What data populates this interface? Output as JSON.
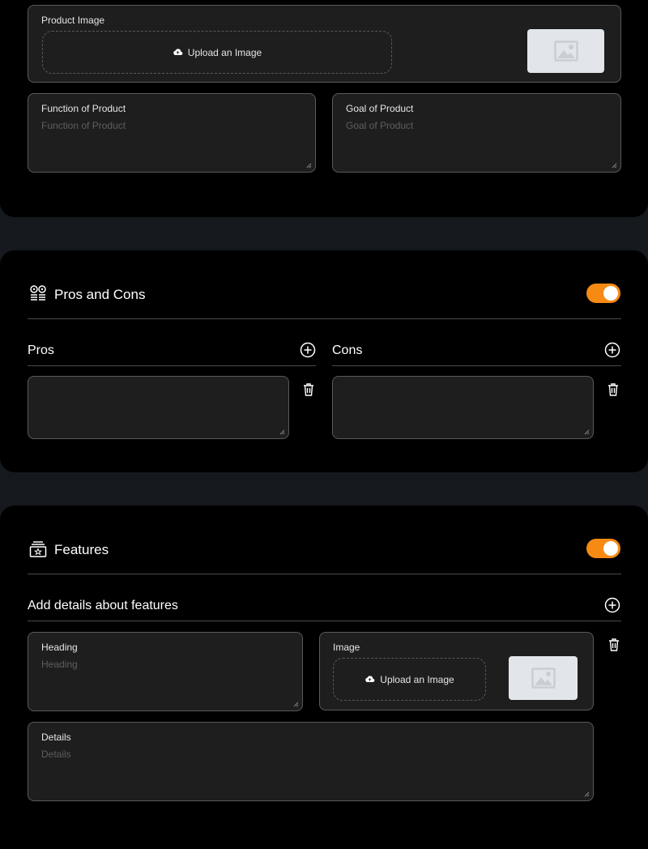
{
  "product": {
    "image_label": "Product Image",
    "upload_label": "Upload an Image",
    "function_label": "Function of Product",
    "function_placeholder": "Function of Product",
    "goal_label": "Goal of Product",
    "goal_placeholder": "Goal of Product"
  },
  "pros_cons": {
    "title": "Pros and Cons",
    "pros_label": "Pros",
    "cons_label": "Cons",
    "enabled": true
  },
  "features": {
    "title": "Features",
    "add_details_label": "Add details about features",
    "heading_label": "Heading",
    "heading_placeholder": "Heading",
    "image_label": "Image",
    "upload_label": "Upload an Image",
    "details_label": "Details",
    "details_placeholder": "Details",
    "enabled": true
  },
  "colors": {
    "accent": "#f68a13",
    "card_bg": "#000000",
    "page_bg": "#15181c",
    "field_bg": "#1e1e1e",
    "border": "#5a5a5a"
  }
}
